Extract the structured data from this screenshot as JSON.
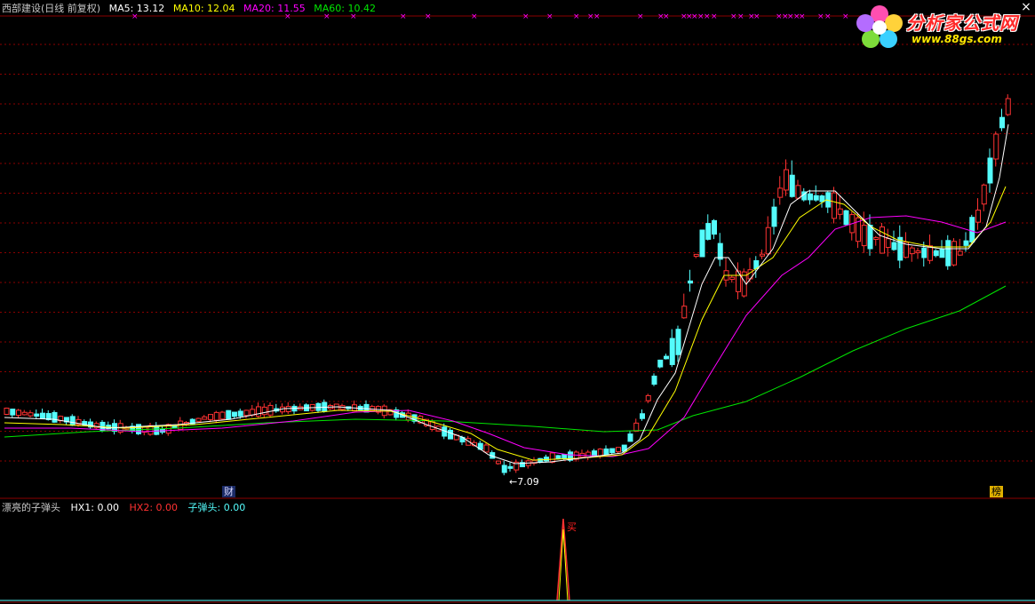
{
  "header": {
    "title": "西部建设(日线 前复权)",
    "ma5": "MA5: 13.12",
    "ma10": "MA10: 12.04",
    "ma20": "MA20: 11.55",
    "ma60": "MA60: 10.42"
  },
  "indicator": {
    "name": "漂亮的子弹头",
    "hx1": "HX1: 0.00",
    "hx2": "HX2: 0.00",
    "bullet": "子弹头: 0.00",
    "buy_label": "买"
  },
  "markers": {
    "fin_label": "财",
    "rank_label": "榜"
  },
  "min_label": "←7.09",
  "logo": {
    "title": "分析家公式网",
    "url": "www.88gs.com"
  },
  "colors": {
    "background": "#000000",
    "up": "#ff3232",
    "down": "#54fcfc",
    "ma5": "#ffffff",
    "ma10": "#ffff00",
    "ma20": "#ff00ff",
    "ma60": "#00e600",
    "grid": "#8b0000",
    "star": "#ff00ff"
  }
}
